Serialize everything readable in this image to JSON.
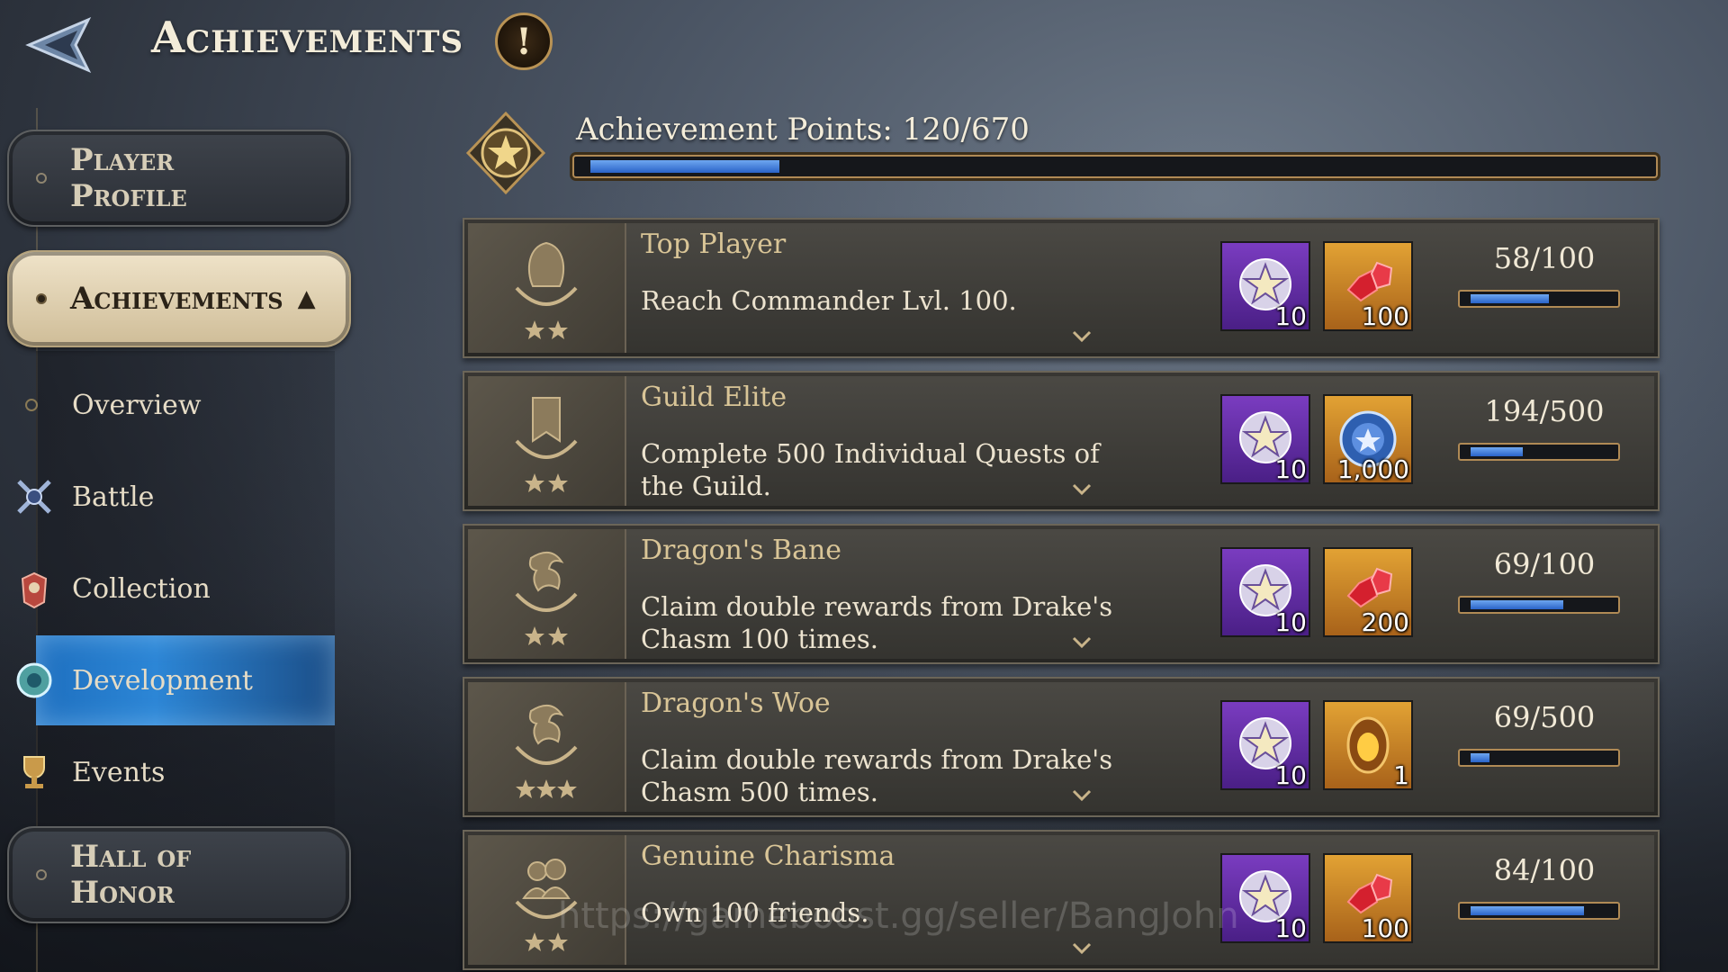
{
  "header": {
    "title": "Achievements",
    "info_label": "!"
  },
  "sidebar": {
    "categories": [
      {
        "label": "Player Profile",
        "active": false
      },
      {
        "label": "Achievements",
        "active": true
      },
      {
        "label": "Hall of Honor",
        "active": false
      }
    ],
    "sub_items": [
      {
        "label": "Overview",
        "icon": "dot-icon",
        "active": false
      },
      {
        "label": "Battle",
        "icon": "crossed-swords-icon",
        "active": false
      },
      {
        "label": "Collection",
        "icon": "armor-icon",
        "active": false
      },
      {
        "label": "Development",
        "icon": "gear-shield-icon",
        "active": true
      },
      {
        "label": "Events",
        "icon": "trophy-icon",
        "active": false
      }
    ]
  },
  "points": {
    "label": "Achievement Points:  120/670",
    "current": 120,
    "total": 670
  },
  "achievements": [
    {
      "title": "Top Player",
      "description": "Reach Commander Lvl. 100.",
      "emblem": "helmet-emblem-icon",
      "reward1_qty": "10",
      "reward1_icon": "star-medal-icon",
      "reward2_qty": "100",
      "reward2_icon": "red-gems-icon",
      "progress": "58/100",
      "fraction": 0.58
    },
    {
      "title": "Guild Elite",
      "description": "Complete 500 Individual Quests of the Guild.",
      "emblem": "banner-emblem-icon",
      "reward1_qty": "10",
      "reward1_icon": "star-medal-icon",
      "reward2_qty": "1,000",
      "reward2_icon": "blue-orb-icon",
      "progress": "194/500",
      "fraction": 0.388
    },
    {
      "title": "Dragon's Bane",
      "description": "Claim double rewards from Drake's Chasm 100 times.",
      "emblem": "dragon-emblem-icon",
      "reward1_qty": "10",
      "reward1_icon": "star-medal-icon",
      "reward2_qty": "200",
      "reward2_icon": "red-gems-icon",
      "progress": "69/100",
      "fraction": 0.69
    },
    {
      "title": "Dragon's Woe",
      "description": "Claim double rewards from Drake's Chasm 500 times.",
      "emblem": "dragon-emblem-icon",
      "reward1_qty": "10",
      "reward1_icon": "star-medal-icon",
      "reward2_qty": "1",
      "reward2_icon": "amber-relic-icon",
      "progress": "69/500",
      "fraction": 0.138
    },
    {
      "title": "Genuine Charisma",
      "description": "Own 100 friends.",
      "emblem": "friends-emblem-icon",
      "reward1_qty": "10",
      "reward1_icon": "star-medal-icon",
      "reward2_qty": "100",
      "reward2_icon": "red-gems-icon",
      "progress": "84/100",
      "fraction": 0.84
    }
  ],
  "watermark": "https://gameboost.gg/seller/BangJohn",
  "colors": {
    "accent_blue": "#2c86d6",
    "gold": "#b08a55",
    "reward_purple": "#7a3cc0",
    "reward_gold": "#e2a234"
  }
}
